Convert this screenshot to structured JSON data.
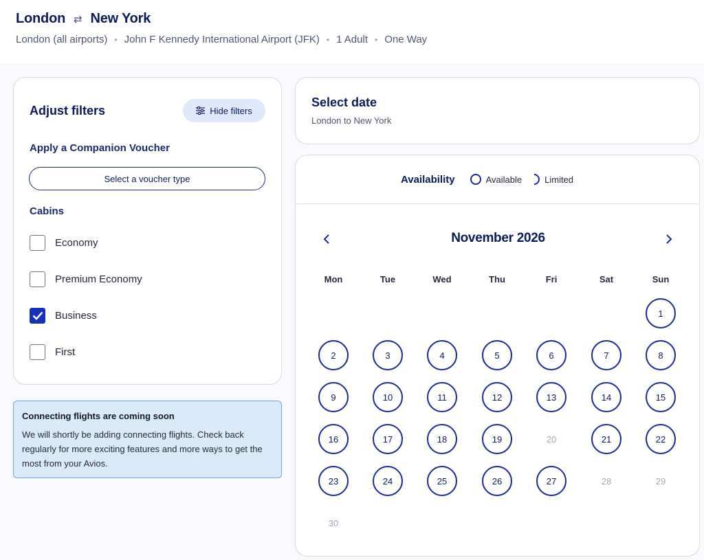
{
  "header": {
    "origin": "London",
    "swap_icon": "swap-arrows-icon",
    "destination": "New York",
    "details": [
      "London (all airports)",
      "John F Kennedy International Airport (JFK)",
      "1 Adult",
      "One Way"
    ]
  },
  "filters": {
    "title": "Adjust filters",
    "hide_label": "Hide filters",
    "voucher_title": "Apply a Companion Voucher",
    "voucher_button": "Select a voucher type",
    "cabins_title": "Cabins",
    "cabins": [
      {
        "label": "Economy",
        "checked": false
      },
      {
        "label": "Premium Economy",
        "checked": false
      },
      {
        "label": "Business",
        "checked": true
      },
      {
        "label": "First",
        "checked": false
      }
    ]
  },
  "notice": {
    "title": "Connecting flights are coming soon",
    "body": "We will shortly be adding connecting flights. Check back regularly for more exciting features and more ways to get the most from your Avios."
  },
  "select_date": {
    "title": "Select date",
    "subtitle": "London to New York"
  },
  "calendar": {
    "availability_title": "Availability",
    "legend_available": "Available",
    "legend_limited": "Limited",
    "month": "November 2026",
    "weekdays": [
      "Mon",
      "Tue",
      "Wed",
      "Thu",
      "Fri",
      "Sat",
      "Sun"
    ],
    "start_weekday_index": 6,
    "days_in_month": 30,
    "unavailable_days": [
      20,
      28,
      29,
      30
    ]
  },
  "colors": {
    "brand_navy": "#0b1a5c",
    "accent_blue": "#1631b8",
    "notice_bg": "#d9ebfb"
  }
}
